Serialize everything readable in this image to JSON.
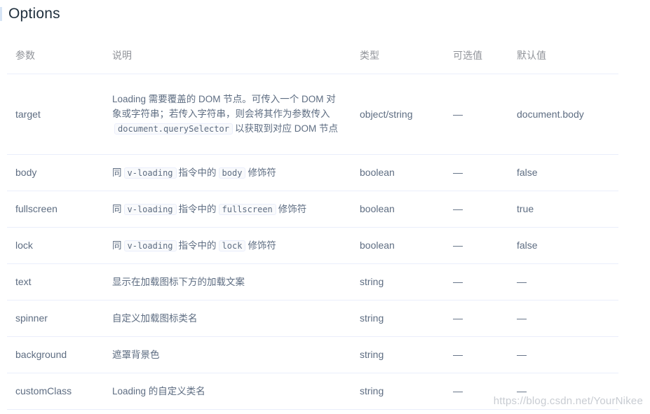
{
  "section": {
    "title": "Options"
  },
  "table": {
    "headers": [
      "参数",
      "说明",
      "类型",
      "可选值",
      "默认值"
    ],
    "rows": [
      {
        "param": "target",
        "desc_parts": [
          "Loading 需要覆盖的 DOM 节点。可传入一个 DOM 对象或字符串；若传入字符串，则会将其作为参数传入",
          "document.querySelector",
          "以获取到对应 DOM 节点"
        ],
        "type": "object/string",
        "options": "—",
        "default": "document.body"
      },
      {
        "param": "body",
        "desc_parts": [
          "同",
          "v-loading",
          "指令中的",
          "body",
          "修饰符"
        ],
        "type": "boolean",
        "options": "—",
        "default": "false"
      },
      {
        "param": "fullscreen",
        "desc_parts": [
          "同",
          "v-loading",
          "指令中的",
          "fullscreen",
          "修饰符"
        ],
        "type": "boolean",
        "options": "—",
        "default": "true"
      },
      {
        "param": "lock",
        "desc_parts": [
          "同",
          "v-loading",
          "指令中的",
          "lock",
          "修饰符"
        ],
        "type": "boolean",
        "options": "—",
        "default": "false"
      },
      {
        "param": "text",
        "desc": "显示在加载图标下方的加载文案",
        "type": "string",
        "options": "—",
        "default": "—"
      },
      {
        "param": "spinner",
        "desc": "自定义加载图标类名",
        "type": "string",
        "options": "—",
        "default": "—"
      },
      {
        "param": "background",
        "desc": "遮罩背景色",
        "type": "string",
        "options": "—",
        "default": "—"
      },
      {
        "param": "customClass",
        "desc": "Loading 的自定义类名",
        "type": "string",
        "options": "—",
        "default": "—"
      }
    ]
  },
  "watermark": "https://blog.csdn.net/YourNikee"
}
